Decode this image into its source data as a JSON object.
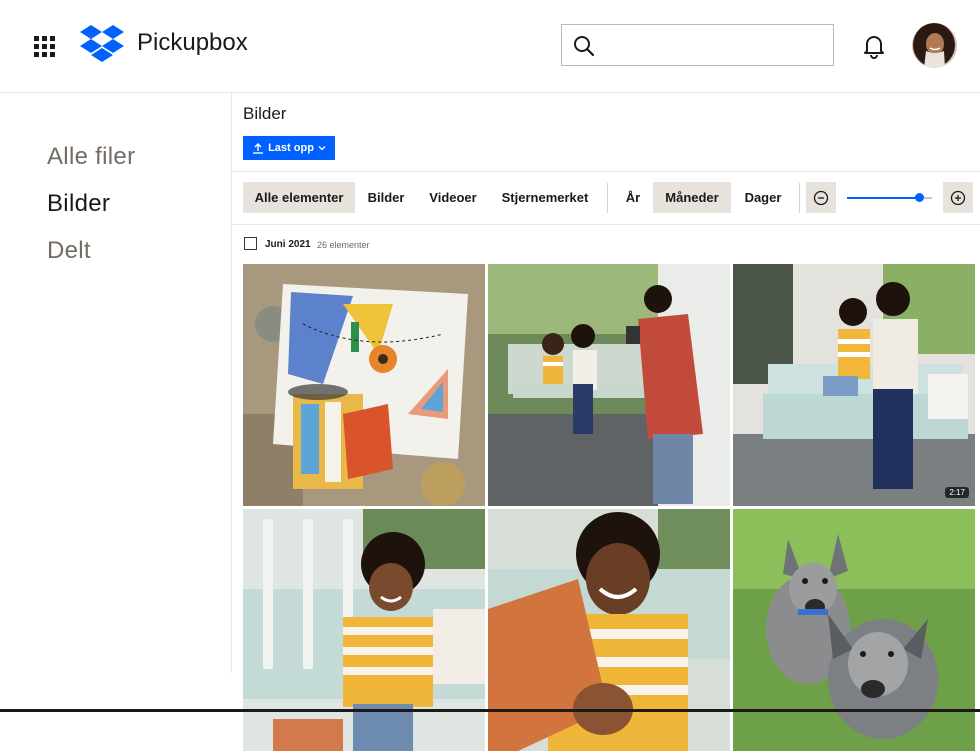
{
  "header": {
    "app_name": "Pickupbox",
    "search_placeholder": "",
    "brand_color": "#0061fe"
  },
  "sidebar": {
    "items": [
      {
        "label": "Alle filer",
        "active": false
      },
      {
        "label": "Bilder",
        "active": true
      },
      {
        "label": "Delt",
        "active": false
      }
    ]
  },
  "main": {
    "title": "Bilder",
    "upload_label": "Last opp",
    "filters": [
      "Alle elementer",
      "Bilder",
      "Videoer",
      "Stjernemerket"
    ],
    "active_filter": "Alle elementer",
    "time_filters": [
      "År",
      "Måneder",
      "Dager"
    ],
    "active_time_filter": "Måneder",
    "zoom_level": 0.85,
    "group": {
      "date": "Juni 2021",
      "count": "26 elementer"
    },
    "photos": [
      {
        "name": "collage-art-photo"
      },
      {
        "name": "porch-swing-photographer-photo"
      },
      {
        "name": "mother-son-swing-video",
        "duration": "2:17"
      },
      {
        "name": "boy-on-bench-photo"
      },
      {
        "name": "boy-closeup-photo"
      },
      {
        "name": "two-dogs-photo"
      }
    ]
  }
}
